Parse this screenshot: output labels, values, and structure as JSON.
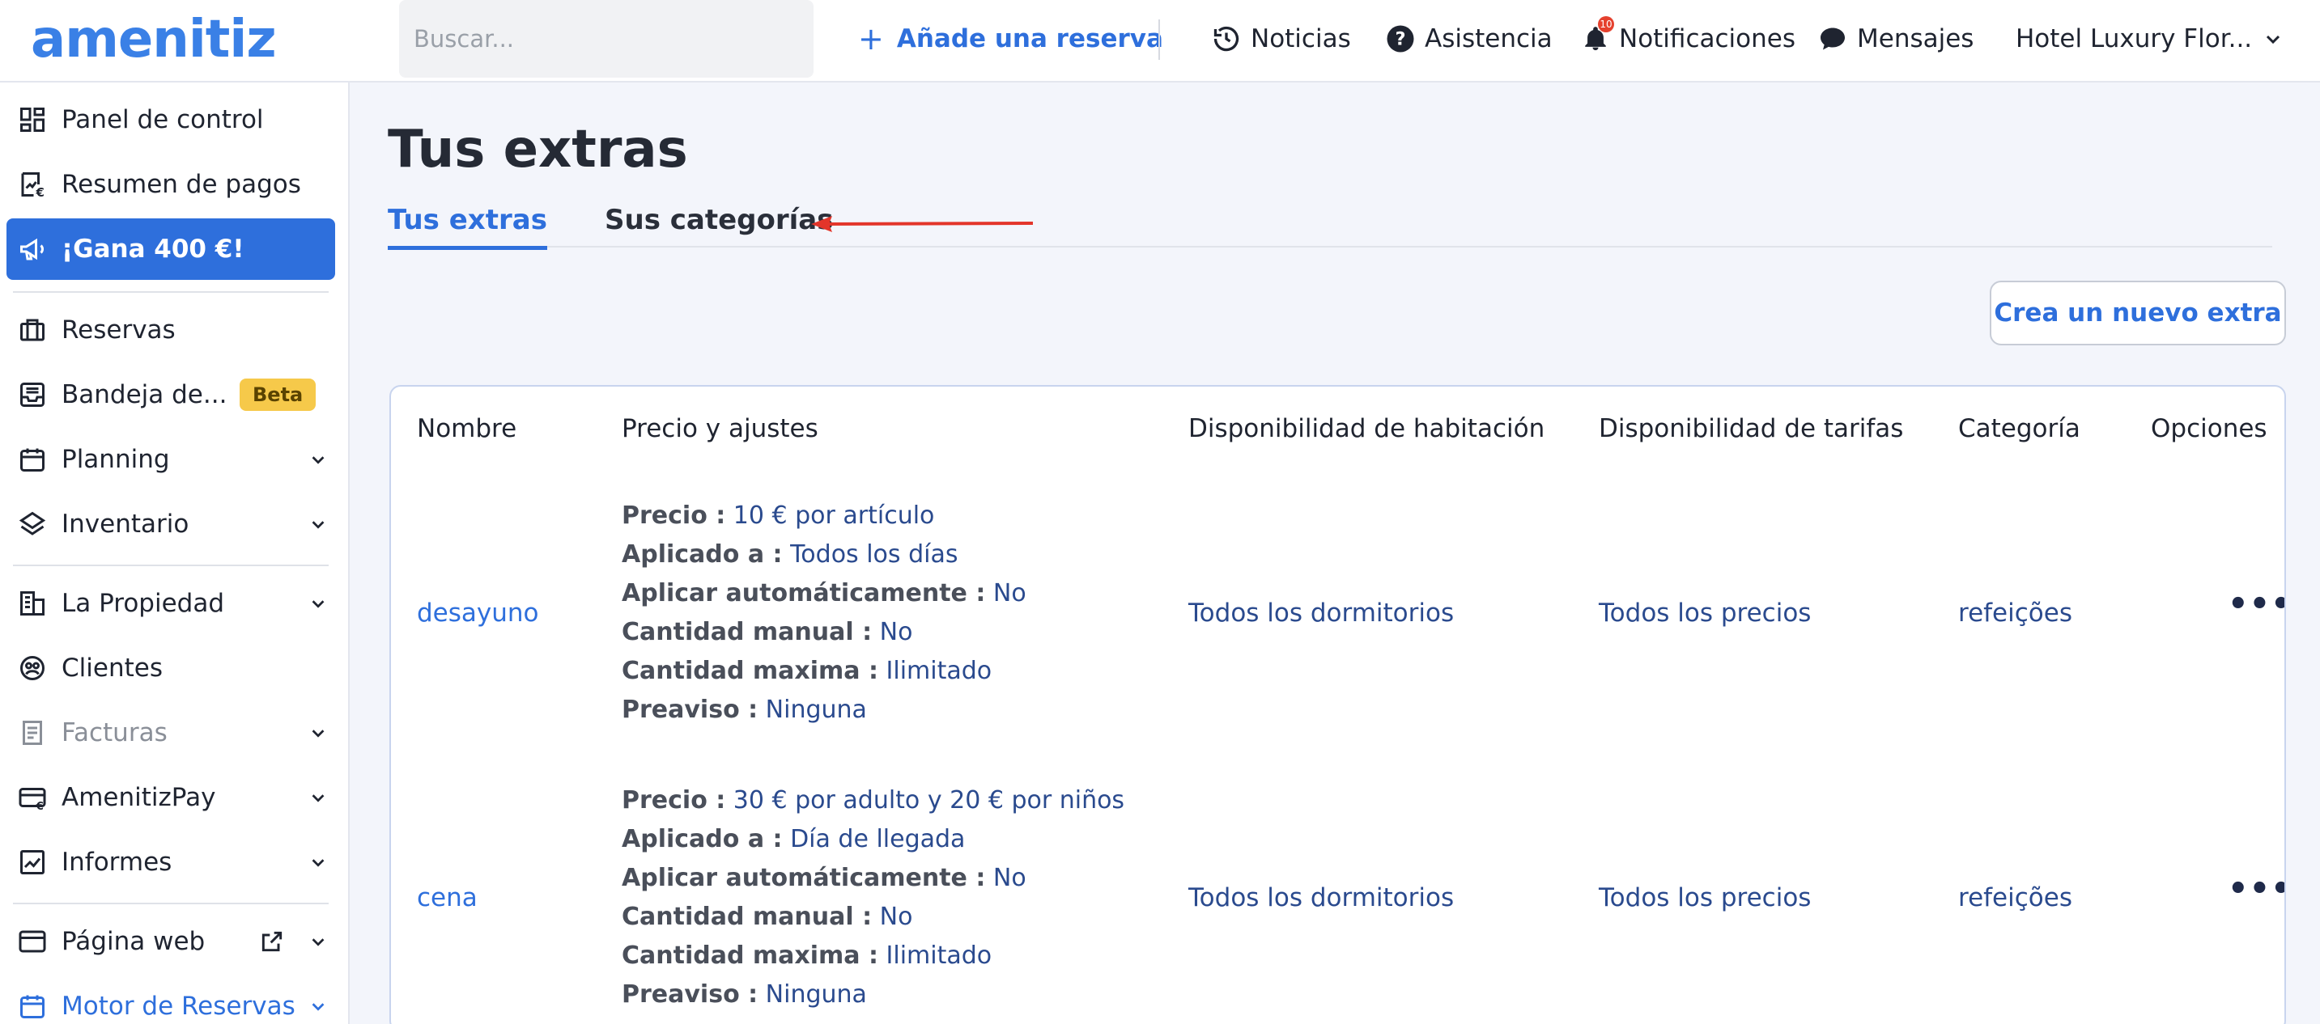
{
  "app": {
    "logo": "amenitiz",
    "brand_color": "#3a80e6"
  },
  "topbar": {
    "search_placeholder": "Buscar...",
    "add_reservation": "Añade una reserva",
    "news": "Noticias",
    "help": "Asistencia",
    "notifications": "Notificaciones",
    "notifications_count": "10",
    "messages": "Mensajes",
    "hotel": "Hotel Luxury Flor..."
  },
  "sidebar": {
    "items": [
      {
        "label": "Panel de control",
        "icon": "dashboard-icon"
      },
      {
        "label": "Resumen de pagos",
        "icon": "payments-icon"
      },
      {
        "label": "¡Gana 400 €!",
        "icon": "megaphone-icon",
        "active": true
      },
      {
        "label": "Reservas",
        "icon": "suitcase-icon"
      },
      {
        "label": "Bandeja de...",
        "icon": "inbox-icon",
        "badge": "Beta"
      },
      {
        "label": "Planning",
        "icon": "calendar-icon"
      },
      {
        "label": "Inventario",
        "icon": "layers-icon"
      },
      {
        "label": "La Propiedad",
        "icon": "building-icon"
      },
      {
        "label": "Clientes",
        "icon": "users-icon"
      },
      {
        "label": "Facturas",
        "icon": "invoice-icon"
      },
      {
        "label": "AmenitizPay",
        "icon": "card-icon"
      },
      {
        "label": "Informes",
        "icon": "chart-icon"
      },
      {
        "label": "Página web",
        "icon": "browser-icon"
      },
      {
        "label": "Motor de Reservas",
        "icon": "booking-engine-icon"
      }
    ]
  },
  "main": {
    "title": "Tus extras",
    "tabs": [
      {
        "label": "Tus extras"
      },
      {
        "label": "Sus categorías"
      }
    ],
    "new_button": "Crea un nuevo extra",
    "table": {
      "headers": [
        "Nombre",
        "Precio y ajustes",
        "Disponibilidad de habitación",
        "Disponibilidad de tarifas",
        "Categoría",
        "Opciones"
      ],
      "rows": [
        {
          "name": "desayuno",
          "details": [
            {
              "k": "Precio :",
              "v": "10 € por artículo"
            },
            {
              "k": "Aplicado a :",
              "v": "Todos los días"
            },
            {
              "k": "Aplicar automáticamente :",
              "v": "No"
            },
            {
              "k": "Cantidad manual :",
              "v": "No"
            },
            {
              "k": "Cantidad maxima :",
              "v": "Ilimitado"
            },
            {
              "k": "Preaviso :",
              "v": "Ninguna"
            }
          ],
          "rooms": "Todos los dormitorios",
          "rates": "Todos los precios",
          "category": "refeições",
          "options": "•••"
        },
        {
          "name": "cena",
          "details": [
            {
              "k": "Precio :",
              "v": "30 € por adulto y 20 € por niños"
            },
            {
              "k": "Aplicado a :",
              "v": "Día de llegada"
            },
            {
              "k": "Aplicar automáticamente :",
              "v": "No"
            },
            {
              "k": "Cantidad manual :",
              "v": "No"
            },
            {
              "k": "Cantidad maxima :",
              "v": "Ilimitado"
            },
            {
              "k": "Preaviso :",
              "v": "Ninguna"
            }
          ],
          "rooms": "Todos los dormitorios",
          "rates": "Todos los precios",
          "category": "refeições",
          "options": "•••"
        }
      ]
    }
  }
}
